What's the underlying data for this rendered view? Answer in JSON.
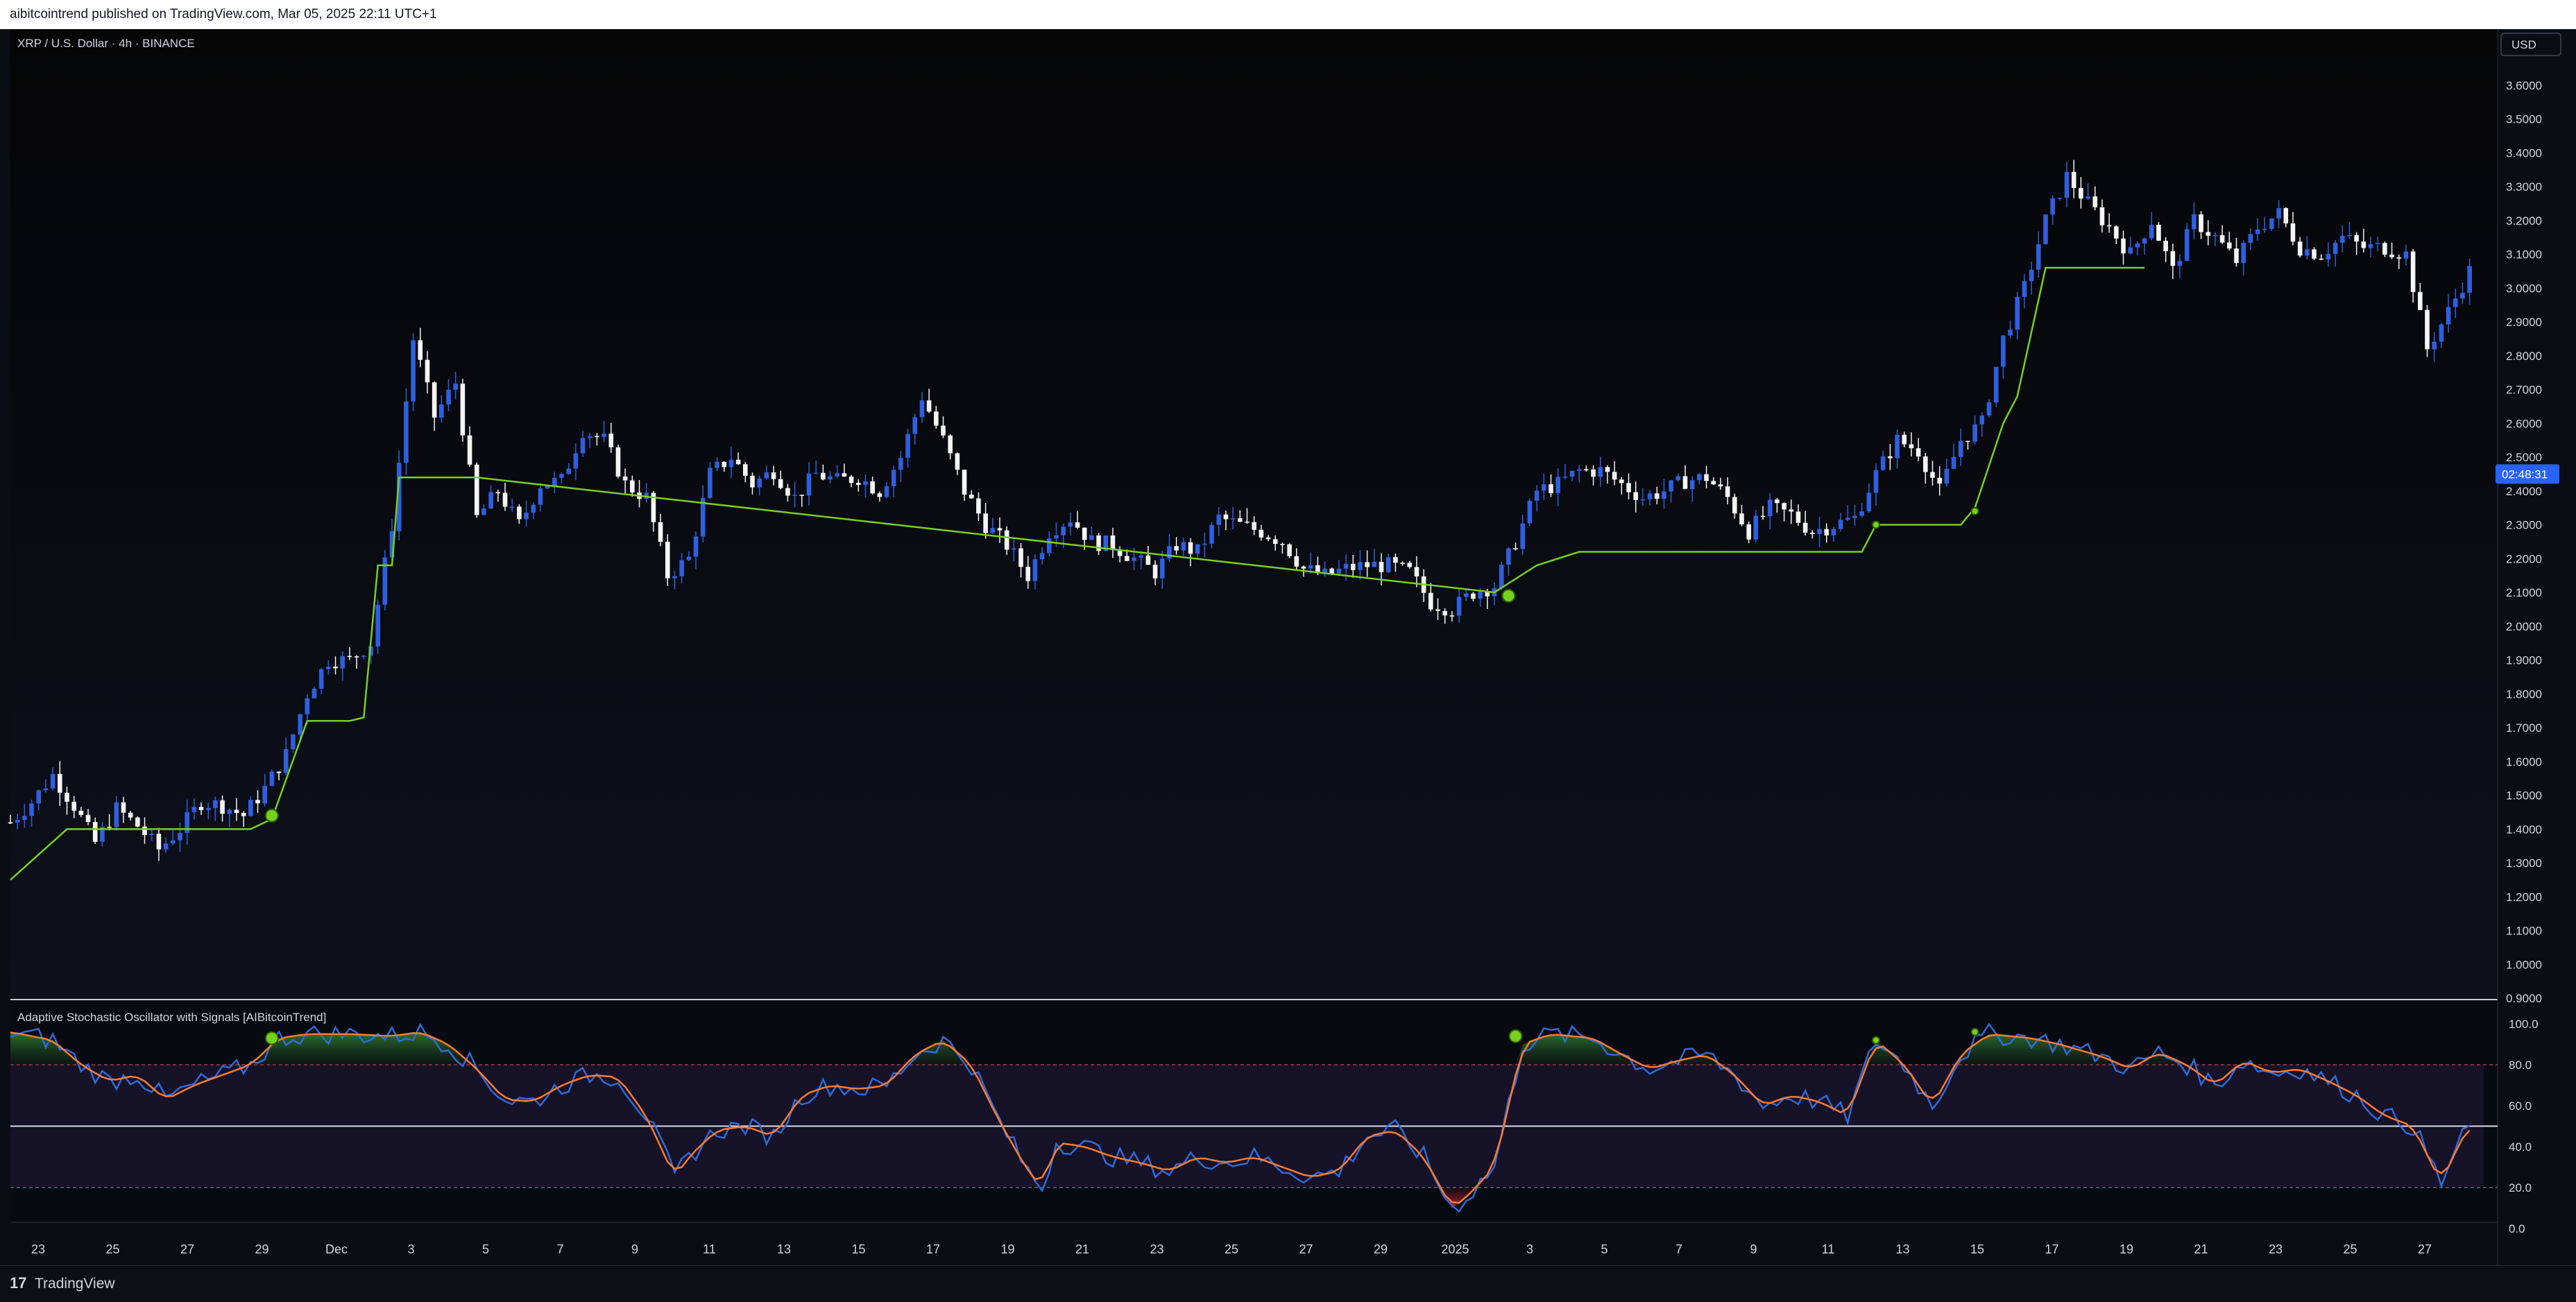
{
  "header": {
    "publish_text": "aibitcointrend published on TradingView.com, Mar 05, 2025 22:11 UTC+1"
  },
  "footer": {
    "logo_glyph": "17",
    "brand": "TradingView"
  },
  "chart_data": [
    {
      "type": "candlestick",
      "title": "XRP / U.S. Dollar · 4h · BINANCE",
      "currency_label": "USD",
      "countdown_label": "02:48:31",
      "ylim": [
        0.9,
        3.62
      ],
      "y_ticks": [
        "3.6000",
        "3.5000",
        "3.4000",
        "3.3000",
        "3.2000",
        "3.1000",
        "3.0000",
        "2.9000",
        "2.8000",
        "2.7000",
        "2.6000",
        "2.5000",
        "2.4000",
        "2.3000",
        "2.2000",
        "2.1000",
        "2.0000",
        "1.9000",
        "1.8000",
        "1.7000",
        "1.6000",
        "1.5000",
        "1.4000",
        "1.3000",
        "1.2000",
        "1.1000",
        "1.0000",
        "0.9000"
      ],
      "price_path": [
        [
          0,
          1.42
        ],
        [
          3,
          1.48
        ],
        [
          6,
          1.56
        ],
        [
          9,
          1.47
        ],
        [
          12,
          1.36
        ],
        [
          15,
          1.46
        ],
        [
          18,
          1.41
        ],
        [
          21,
          1.34
        ],
        [
          24,
          1.4
        ],
        [
          27,
          1.48
        ],
        [
          30,
          1.47
        ],
        [
          33,
          1.44
        ],
        [
          36,
          1.52
        ],
        [
          39,
          1.62
        ],
        [
          42,
          1.8
        ],
        [
          45,
          1.9
        ],
        [
          48,
          1.9
        ],
        [
          51,
          1.95
        ],
        [
          54,
          2.3
        ],
        [
          57,
          2.85
        ],
        [
          60,
          2.62
        ],
        [
          63,
          2.72
        ],
        [
          66,
          2.32
        ],
        [
          69,
          2.4
        ],
        [
          72,
          2.3
        ],
        [
          75,
          2.42
        ],
        [
          78,
          2.43
        ],
        [
          81,
          2.58
        ],
        [
          84,
          2.55
        ],
        [
          87,
          2.42
        ],
        [
          90,
          2.38
        ],
        [
          93,
          2.15
        ],
        [
          96,
          2.2
        ],
        [
          99,
          2.45
        ],
        [
          102,
          2.5
        ],
        [
          105,
          2.42
        ],
        [
          108,
          2.46
        ],
        [
          111,
          2.38
        ],
        [
          114,
          2.45
        ],
        [
          117,
          2.43
        ],
        [
          120,
          2.44
        ],
        [
          123,
          2.4
        ],
        [
          126,
          2.5
        ],
        [
          129,
          2.68
        ],
        [
          132,
          2.55
        ],
        [
          135,
          2.4
        ],
        [
          138,
          2.3
        ],
        [
          141,
          2.24
        ],
        [
          144,
          2.15
        ],
        [
          147,
          2.28
        ],
        [
          150,
          2.32
        ],
        [
          153,
          2.25
        ],
        [
          156,
          2.24
        ],
        [
          159,
          2.2
        ],
        [
          162,
          2.16
        ],
        [
          165,
          2.24
        ],
        [
          168,
          2.22
        ],
        [
          171,
          2.32
        ],
        [
          174,
          2.3
        ],
        [
          177,
          2.28
        ],
        [
          180,
          2.25
        ],
        [
          183,
          2.17
        ],
        [
          186,
          2.15
        ],
        [
          189,
          2.17
        ],
        [
          192,
          2.18
        ],
        [
          195,
          2.18
        ],
        [
          198,
          2.16
        ],
        [
          201,
          2.07
        ],
        [
          204,
          2.05
        ],
        [
          207,
          2.1
        ],
        [
          210,
          2.12
        ],
        [
          213,
          2.25
        ],
        [
          216,
          2.4
        ],
        [
          219,
          2.42
        ],
        [
          222,
          2.46
        ],
        [
          225,
          2.46
        ],
        [
          228,
          2.42
        ],
        [
          231,
          2.38
        ],
        [
          234,
          2.4
        ],
        [
          237,
          2.43
        ],
        [
          240,
          2.44
        ],
        [
          243,
          2.38
        ],
        [
          246,
          2.28
        ],
        [
          249,
          2.35
        ],
        [
          252,
          2.33
        ],
        [
          255,
          2.28
        ],
        [
          258,
          2.3
        ],
        [
          261,
          2.32
        ],
        [
          264,
          2.45
        ],
        [
          267,
          2.55
        ],
        [
          270,
          2.52
        ],
        [
          273,
          2.4
        ],
        [
          276,
          2.55
        ],
        [
          279,
          2.6
        ],
        [
          282,
          2.85
        ],
        [
          285,
          3.0
        ],
        [
          288,
          3.2
        ],
        [
          291,
          3.33
        ],
        [
          294,
          3.25
        ],
        [
          297,
          3.18
        ],
        [
          300,
          3.1
        ],
        [
          303,
          3.2
        ],
        [
          306,
          3.05
        ],
        [
          309,
          3.2
        ],
        [
          312,
          3.15
        ],
        [
          315,
          3.08
        ],
        [
          318,
          3.18
        ],
        [
          321,
          3.22
        ],
        [
          324,
          3.12
        ],
        [
          327,
          3.1
        ],
        [
          330,
          3.15
        ],
        [
          333,
          3.12
        ],
        [
          336,
          3.12
        ],
        [
          339,
          3.1
        ],
        [
          342,
          2.82
        ],
        [
          345,
          2.93
        ],
        [
          348,
          3.05
        ]
      ],
      "trail_path": [
        [
          0,
          1.25
        ],
        [
          8,
          1.4
        ],
        [
          34,
          1.4
        ],
        [
          37,
          1.43
        ],
        [
          42,
          1.72
        ],
        [
          48,
          1.72
        ],
        [
          50,
          1.73
        ],
        [
          52,
          2.18
        ],
        [
          54,
          2.18
        ],
        [
          55,
          2.44
        ],
        [
          66,
          2.44
        ],
        [
          210,
          2.1
        ],
        [
          216,
          2.18
        ],
        [
          222,
          2.22
        ],
        [
          262,
          2.22
        ],
        [
          264,
          2.3
        ],
        [
          276,
          2.3
        ],
        [
          278,
          2.35
        ],
        [
          282,
          2.6
        ],
        [
          284,
          2.68
        ],
        [
          288,
          3.06
        ],
        [
          302,
          3.06
        ]
      ],
      "buy_signals": [
        [
          37,
          1.44
        ],
        [
          212,
          2.09
        ],
        [
          264,
          2.3
        ],
        [
          278,
          2.34
        ]
      ],
      "x_tick_labels": [
        "23",
        "25",
        "27",
        "29",
        "Dec",
        "3",
        "5",
        "7",
        "9",
        "11",
        "13",
        "15",
        "17",
        "19",
        "21",
        "23",
        "25",
        "27",
        "29",
        "2025",
        "3",
        "5",
        "7",
        "9",
        "11",
        "13",
        "15",
        "17",
        "19",
        "21",
        "23",
        "25",
        "27"
      ]
    },
    {
      "type": "line",
      "title": "Adaptive Stochastic Oscillator with Signals [AIBitcoinTrend]",
      "ylim": [
        0,
        100
      ],
      "y_ticks": [
        "100.0",
        "80.0",
        "60.0",
        "40.0",
        "20.0",
        "0.0"
      ],
      "levels": {
        "upper": 80,
        "mid": 50,
        "lower": 20
      },
      "osc_path": [
        [
          0,
          96
        ],
        [
          6,
          92
        ],
        [
          10,
          80
        ],
        [
          14,
          72
        ],
        [
          18,
          75
        ],
        [
          22,
          63
        ],
        [
          26,
          70
        ],
        [
          30,
          75
        ],
        [
          34,
          80
        ],
        [
          38,
          93
        ],
        [
          42,
          95
        ],
        [
          48,
          95
        ],
        [
          54,
          94
        ],
        [
          58,
          96
        ],
        [
          62,
          90
        ],
        [
          66,
          78
        ],
        [
          70,
          63
        ],
        [
          74,
          62
        ],
        [
          78,
          70
        ],
        [
          82,
          75
        ],
        [
          86,
          74
        ],
        [
          90,
          55
        ],
        [
          94,
          25
        ],
        [
          96,
          35
        ],
        [
          100,
          48
        ],
        [
          104,
          50
        ],
        [
          108,
          45
        ],
        [
          112,
          65
        ],
        [
          116,
          70
        ],
        [
          120,
          68
        ],
        [
          124,
          70
        ],
        [
          128,
          85
        ],
        [
          132,
          92
        ],
        [
          136,
          80
        ],
        [
          140,
          52
        ],
        [
          144,
          28
        ],
        [
          146,
          20
        ],
        [
          148,
          42
        ],
        [
          152,
          40
        ],
        [
          156,
          35
        ],
        [
          160,
          32
        ],
        [
          164,
          28
        ],
        [
          168,
          35
        ],
        [
          172,
          32
        ],
        [
          176,
          35
        ],
        [
          180,
          30
        ],
        [
          184,
          25
        ],
        [
          188,
          28
        ],
        [
          192,
          45
        ],
        [
          196,
          48
        ],
        [
          200,
          35
        ],
        [
          204,
          10
        ],
        [
          206,
          15
        ],
        [
          210,
          30
        ],
        [
          214,
          90
        ],
        [
          218,
          95
        ],
        [
          224,
          93
        ],
        [
          228,
          85
        ],
        [
          232,
          78
        ],
        [
          236,
          82
        ],
        [
          240,
          85
        ],
        [
          244,
          75
        ],
        [
          248,
          60
        ],
        [
          252,
          65
        ],
        [
          256,
          62
        ],
        [
          260,
          55
        ],
        [
          264,
          92
        ],
        [
          268,
          80
        ],
        [
          272,
          60
        ],
        [
          276,
          85
        ],
        [
          280,
          95
        ],
        [
          286,
          93
        ],
        [
          290,
          90
        ],
        [
          296,
          84
        ],
        [
          300,
          78
        ],
        [
          304,
          86
        ],
        [
          308,
          80
        ],
        [
          312,
          70
        ],
        [
          316,
          82
        ],
        [
          320,
          76
        ],
        [
          324,
          78
        ],
        [
          328,
          72
        ],
        [
          332,
          65
        ],
        [
          336,
          55
        ],
        [
          340,
          50
        ],
        [
          344,
          22
        ],
        [
          346,
          38
        ],
        [
          348,
          50
        ]
      ],
      "signal_markers": [
        [
          37,
          93
        ],
        [
          213,
          94
        ],
        [
          264,
          92
        ],
        [
          278,
          96
        ]
      ]
    }
  ]
}
